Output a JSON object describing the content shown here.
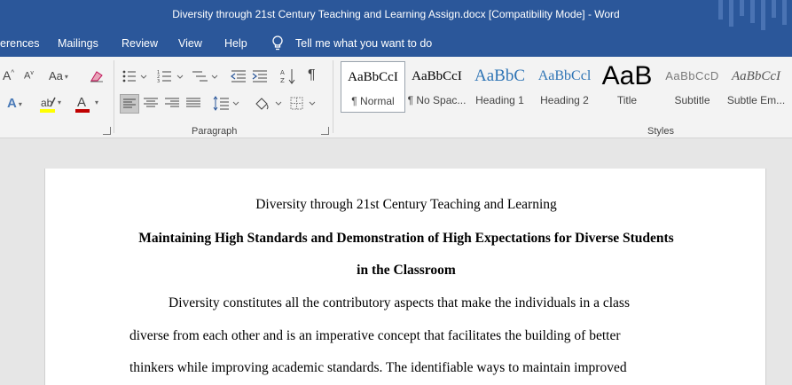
{
  "window": {
    "title": "Diversity through 21st Century Teaching and Learning Assign.docx [Compatibility Mode]  -  Word"
  },
  "menu": {
    "items": [
      "erences",
      "Mailings",
      "Review",
      "View",
      "Help"
    ],
    "tell_me": "Tell me what you want to do"
  },
  "ribbon": {
    "groups": {
      "paragraph": "Paragraph",
      "styles": "Styles"
    },
    "font_buttons": {
      "grow": "A",
      "shrink": "A",
      "change_case": "Aa",
      "text_effects": "A",
      "font_color": "A"
    },
    "styles": [
      {
        "sample": "AaBbCcI",
        "name": "¶ Normal"
      },
      {
        "sample": "AaBbCcI",
        "name": "¶ No Spac..."
      },
      {
        "sample": "AaBbC",
        "name": "Heading 1"
      },
      {
        "sample": "AaBbCcl",
        "name": "Heading 2"
      },
      {
        "sample": "AaB",
        "name": "Title"
      },
      {
        "sample": "AaBbCcD",
        "name": "Subtitle"
      },
      {
        "sample": "AaBbCcI",
        "name": "Subtle Em..."
      }
    ],
    "colors": {
      "highlight": "#ffff00",
      "font_color": "#c00000",
      "accent": "#2b579a"
    }
  },
  "document": {
    "lines": [
      "Diversity through 21st Century Teaching and Learning",
      "Maintaining High Standards and Demonstration of High Expectations for Diverse Students",
      "in the Classroom",
      "Diversity constitutes all the contributory aspects that make the individuals in a class",
      "diverse from each other and is an imperative concept that facilitates the building of better",
      "thinkers while improving academic standards. The identifiable ways to maintain improved"
    ]
  }
}
